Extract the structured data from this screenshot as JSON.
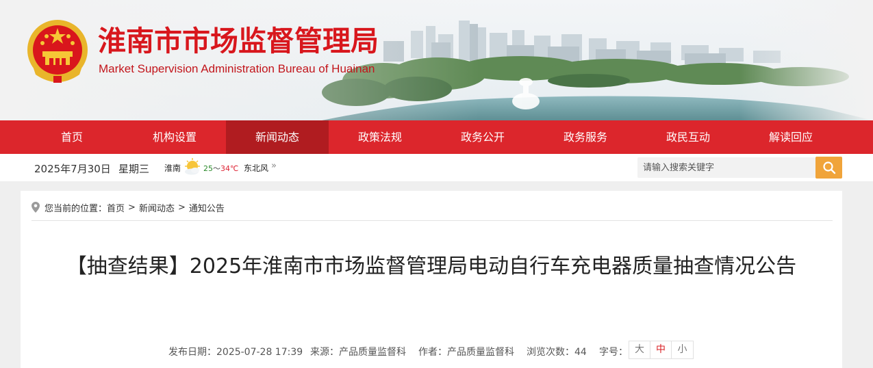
{
  "header": {
    "title": "淮南市市场监督管理局",
    "subtitle": "Market Supervision Administration Bureau of Huainan",
    "colors": {
      "brand_red": "#d8171d",
      "nav_red": "#dc262c",
      "nav_active": "#b01c20",
      "search_orange": "#f0a43a"
    }
  },
  "nav": {
    "items": [
      {
        "label": "首页"
      },
      {
        "label": "机构设置"
      },
      {
        "label": "新闻动态"
      },
      {
        "label": "政策法规"
      },
      {
        "label": "政务公开"
      },
      {
        "label": "政务服务"
      },
      {
        "label": "政民互动"
      },
      {
        "label": "解读回应"
      }
    ],
    "active_index": 2
  },
  "infobar": {
    "date": "2025年7月30日",
    "weekday": "星期三",
    "weather": {
      "city": "淮南",
      "icon": "sun-cloud-icon",
      "low": "25",
      "sep": "～",
      "high": "34℃",
      "wind": "东北风",
      "more": "»"
    },
    "search": {
      "placeholder": "请输入搜索关键字",
      "icon": "search-icon"
    }
  },
  "breadcrumb": {
    "prefix": "您当前的位置：",
    "items": [
      "首页",
      "新闻动态",
      "通知公告"
    ],
    "separator": ">"
  },
  "article": {
    "title": "【抽查结果】2025年淮南市市场监督管理局电动自行车充电器质量抽查情况公告",
    "meta": {
      "date": "发布日期：2025-07-28 17:39",
      "source": "来源：产品质量监督科",
      "author": "作者：产品质量监督科",
      "views": "浏览次数：44",
      "font_size_label": "字号：",
      "font_sizes": [
        "大",
        "中",
        "小"
      ],
      "font_size_active": 1
    }
  }
}
